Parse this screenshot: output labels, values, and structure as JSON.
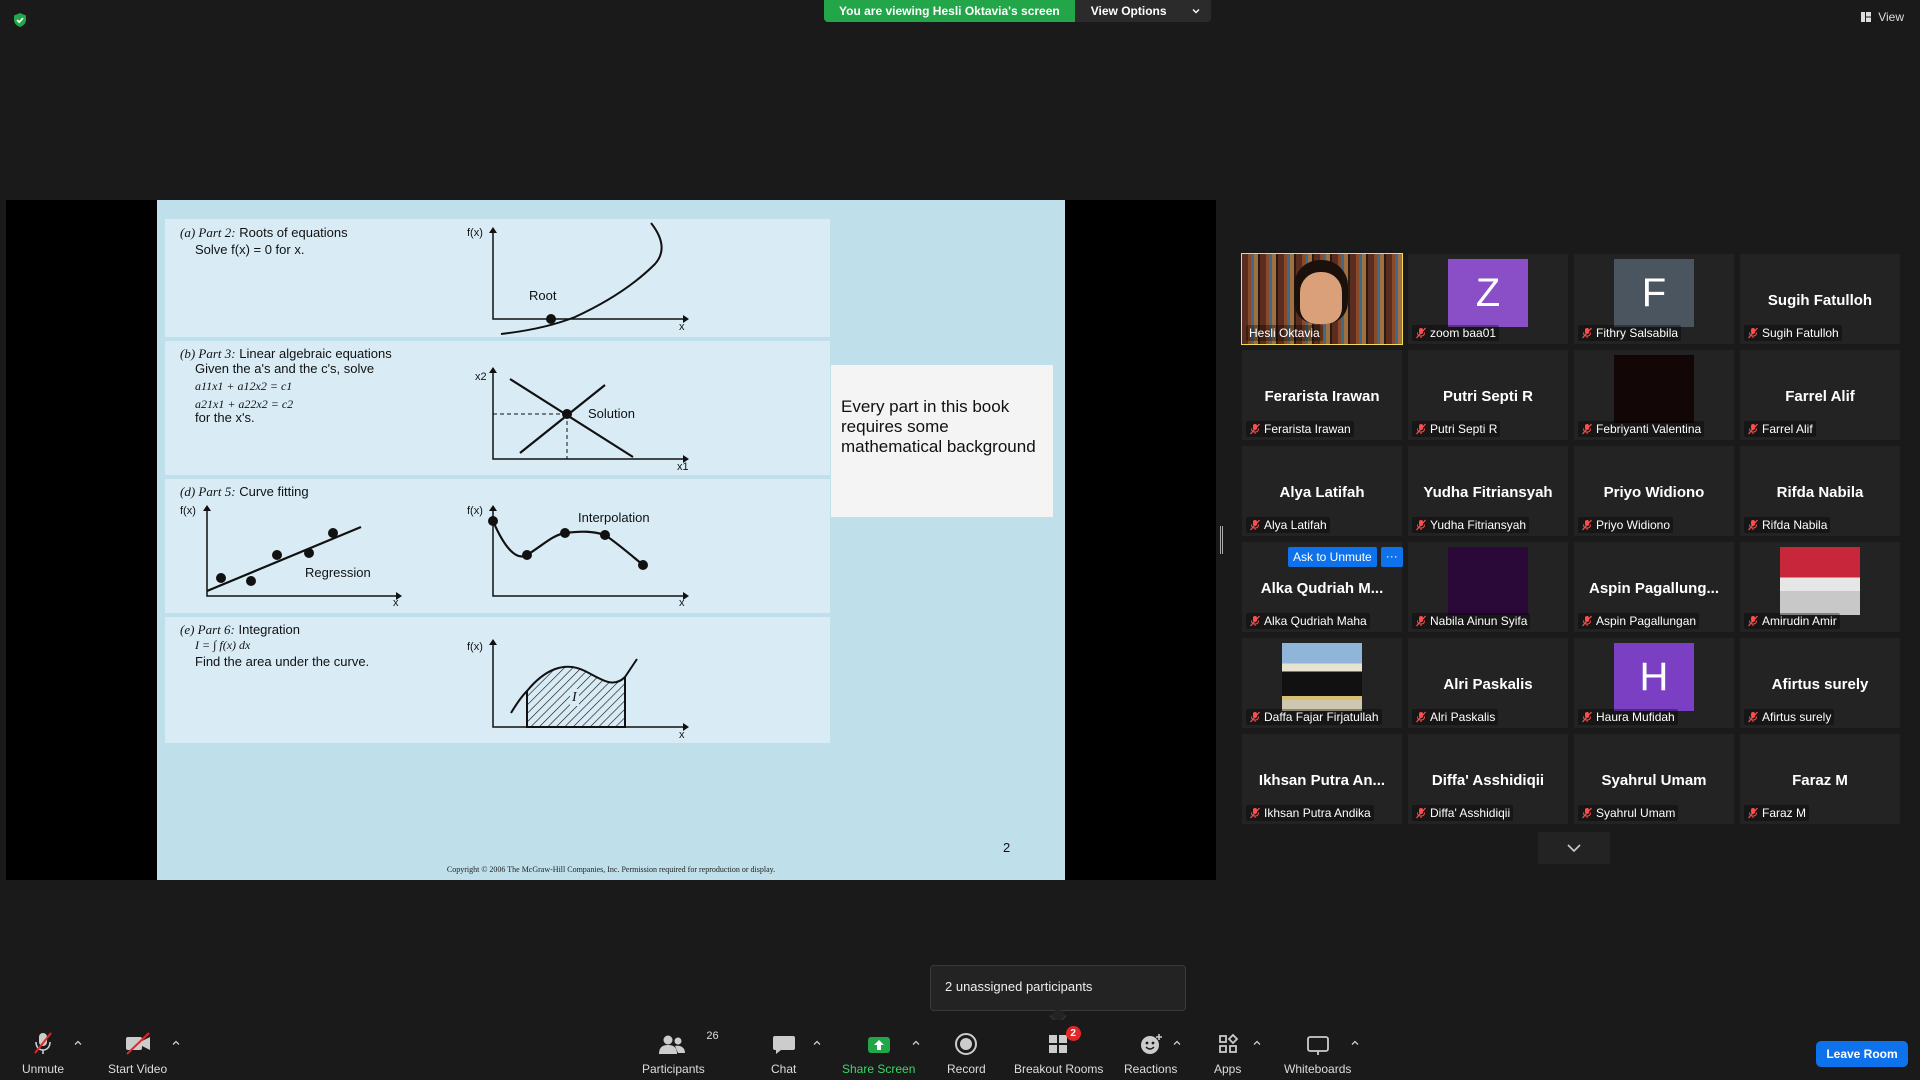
{
  "topbar": {
    "viewing_text": "You are viewing Hesli Oktavia's screen",
    "view_options_label": "View Options",
    "view_label": "View"
  },
  "slide": {
    "part_a_label": "(a) Part 2:",
    "part_a_title": "Roots of equations",
    "part_a_desc": "Solve f(x) = 0 for x.",
    "part_a_root": "Root",
    "part_b_label": "(b) Part 3:",
    "part_b_title": "Linear algebraic equations",
    "part_b_desc": "Given the a's and the c's, solve",
    "part_b_eq1": "a11x1 + a12x2 = c1",
    "part_b_eq2": "a21x1 + a22x2 = c2",
    "part_b_for": "for the x's.",
    "part_b_solution": "Solution",
    "part_d_label": "(d) Part 5:",
    "part_d_title": "Curve fitting",
    "part_d_regression": "Regression",
    "part_d_interpolation": "Interpolation",
    "part_e_label": "(e) Part 6:",
    "part_e_title": "Integration",
    "part_e_formula": "I = ∫ f(x) dx",
    "part_e_desc": "Find the area under the curve.",
    "part_e_area": "I",
    "axis_fx": "f(x)",
    "axis_x": "x",
    "axis_x1": "x1",
    "axis_x2": "x2",
    "callout_text": "Every part in this book requires some mathematical background",
    "page_number": "2",
    "copyright": "Copyright © 2006 The McGraw-Hill Companies, Inc.  Permission required for reproduction or display."
  },
  "gallery": {
    "ask_unmute_label": "Ask to Unmute",
    "more_label": "···",
    "tiles": [
      {
        "name": "Hesli Oktavia",
        "label": "Hesli Oktavia",
        "type": "video",
        "muted": false,
        "active": true
      },
      {
        "name": "zoom baa01",
        "label": "zoom baa01",
        "type": "letter",
        "letter": "Z",
        "color": "#8a4fc7",
        "muted": true
      },
      {
        "name": "Fithry Salsabila",
        "label": "Fithry Salsabila",
        "type": "letter",
        "letter": "F",
        "color": "#4a5560",
        "muted": true
      },
      {
        "name": "Sugih Fatulloh",
        "label": "Sugih Fatulloh",
        "type": "text",
        "muted": true
      },
      {
        "name": "Ferarista Irawan",
        "label": "Ferarista Irawan",
        "type": "text",
        "muted": true
      },
      {
        "name": "Putri Septi R",
        "label": "Putri Septi R",
        "type": "text",
        "muted": true
      },
      {
        "name": "Febriyanti Valentina",
        "label": "Febriyanti Valentina",
        "type": "dark",
        "color": "#120606",
        "muted": true
      },
      {
        "name": "Farrel Alif",
        "label": "Farrel Alif",
        "type": "text",
        "muted": true
      },
      {
        "name": "Alya Latifah",
        "label": "Alya Latifah",
        "type": "text",
        "muted": true
      },
      {
        "name": "Yudha Fitriansyah",
        "label": "Yudha Fitriansyah",
        "type": "text",
        "muted": true
      },
      {
        "name": "Priyo Widiono",
        "label": "Priyo Widiono",
        "type": "text",
        "muted": true
      },
      {
        "name": "Rifda Nabila",
        "label": "Rifda Nabila",
        "type": "text",
        "muted": true
      },
      {
        "name": "Alka  Qudriah  M...",
        "label": "Alka Qudriah Maha",
        "type": "text",
        "muted": true
      },
      {
        "name": "Nabila Ainun Syifa",
        "label": "Nabila Ainun Syifa",
        "type": "dark",
        "color": "#2a0838",
        "muted": true
      },
      {
        "name": "Aspin  Pagallung...",
        "label": "Aspin Pagallungan",
        "type": "text",
        "muted": true
      },
      {
        "name": "Amirudin Amir",
        "label": "Amirudin Amir",
        "type": "photo-red",
        "muted": true
      },
      {
        "name": "Daffa Fajar Firjatullah",
        "label": "Daffa Fajar Firjatullah",
        "type": "photo-kaaba",
        "muted": true
      },
      {
        "name": "Alri Paskalis",
        "label": "Alri Paskalis",
        "type": "text",
        "muted": true
      },
      {
        "name": "Haura Mufidah",
        "label": "Haura Mufidah",
        "type": "letter",
        "letter": "H",
        "color": "#7b3fc4",
        "muted": true
      },
      {
        "name": "Afirtus surely",
        "label": "Afirtus surely",
        "type": "text",
        "muted": true
      },
      {
        "name": "Ikhsan  Putra  An...",
        "label": "Ikhsan Putra Andika",
        "type": "text",
        "muted": true
      },
      {
        "name": "Diffa'  Asshidiqii",
        "label": "Diffa' Asshidiqii",
        "type": "text",
        "muted": true
      },
      {
        "name": "Syahrul Umam",
        "label": "Syahrul Umam",
        "type": "text",
        "muted": true
      },
      {
        "name": "Faraz M",
        "label": "Faraz M",
        "type": "text",
        "muted": true
      }
    ]
  },
  "tooltip": {
    "text": "2 unassigned participants"
  },
  "toolbar": {
    "unmute": "Unmute",
    "start_video": "Start Video",
    "participants": "Participants",
    "participants_count": "26",
    "chat": "Chat",
    "share_screen": "Share Screen",
    "record": "Record",
    "breakout_rooms": "Breakout Rooms",
    "breakout_badge": "2",
    "reactions": "Reactions",
    "apps": "Apps",
    "whiteboards": "Whiteboards",
    "leave_room": "Leave Room"
  },
  "colors": {
    "accent_blue": "#0e72ed",
    "share_green": "#23a549",
    "active_speaker": "#f5d95a",
    "muted_red": "#e02828"
  }
}
